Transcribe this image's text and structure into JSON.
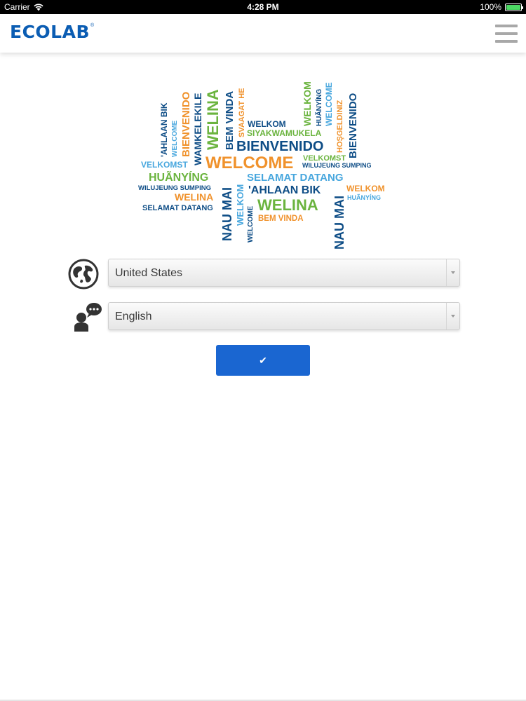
{
  "status_bar": {
    "carrier": "Carrier",
    "time": "4:28 PM",
    "battery": "100%"
  },
  "header": {
    "logo_text": "ECOLAB",
    "logo_reg": "®",
    "menu_icon": "hamburger-icon"
  },
  "word_cloud": {
    "words": [
      "'AHLAAN BIK",
      "WELCOME",
      "BIENVENIDO",
      "WAMKELEKILE",
      "WELINA",
      "BEM VINDA",
      "SVAAGAT HE",
      "WELKOM",
      "SIYAKWAMUKELA",
      "BIENVENIDO",
      "WELKOM",
      "HUÃNYÍNG",
      "WELCOME",
      "HOŞGELDINIZ",
      "BIENVENIDO",
      "VELKOMST",
      "WELCOME",
      "VELKOMST",
      "WILUJEUNG SUMPING",
      "HUÃNYÍNG",
      "SELAMAT DATANG",
      "WILUJEUNG SUMPING",
      "NAU MAI",
      "WELKOM",
      "'AHLAAN BIK",
      "WELKOM",
      "WELINA",
      "WELCOME",
      "HUÃNYÍNG",
      "SELAMAT DATANG",
      "WELINA",
      "NAU MAI",
      "BEM VINDA"
    ]
  },
  "form": {
    "country": {
      "value": "United States",
      "icon": "globe-icon"
    },
    "language": {
      "value": "English",
      "icon": "speech-bubble-person-icon"
    },
    "confirm": {
      "label": "✔"
    }
  },
  "colors": {
    "brand_blue": "#0b5db3",
    "button_blue": "#1a66d1",
    "cloud_dark": "#0e4d86",
    "cloud_light": "#48a7de",
    "cloud_orange": "#f0922c",
    "cloud_green": "#6bb43f"
  }
}
